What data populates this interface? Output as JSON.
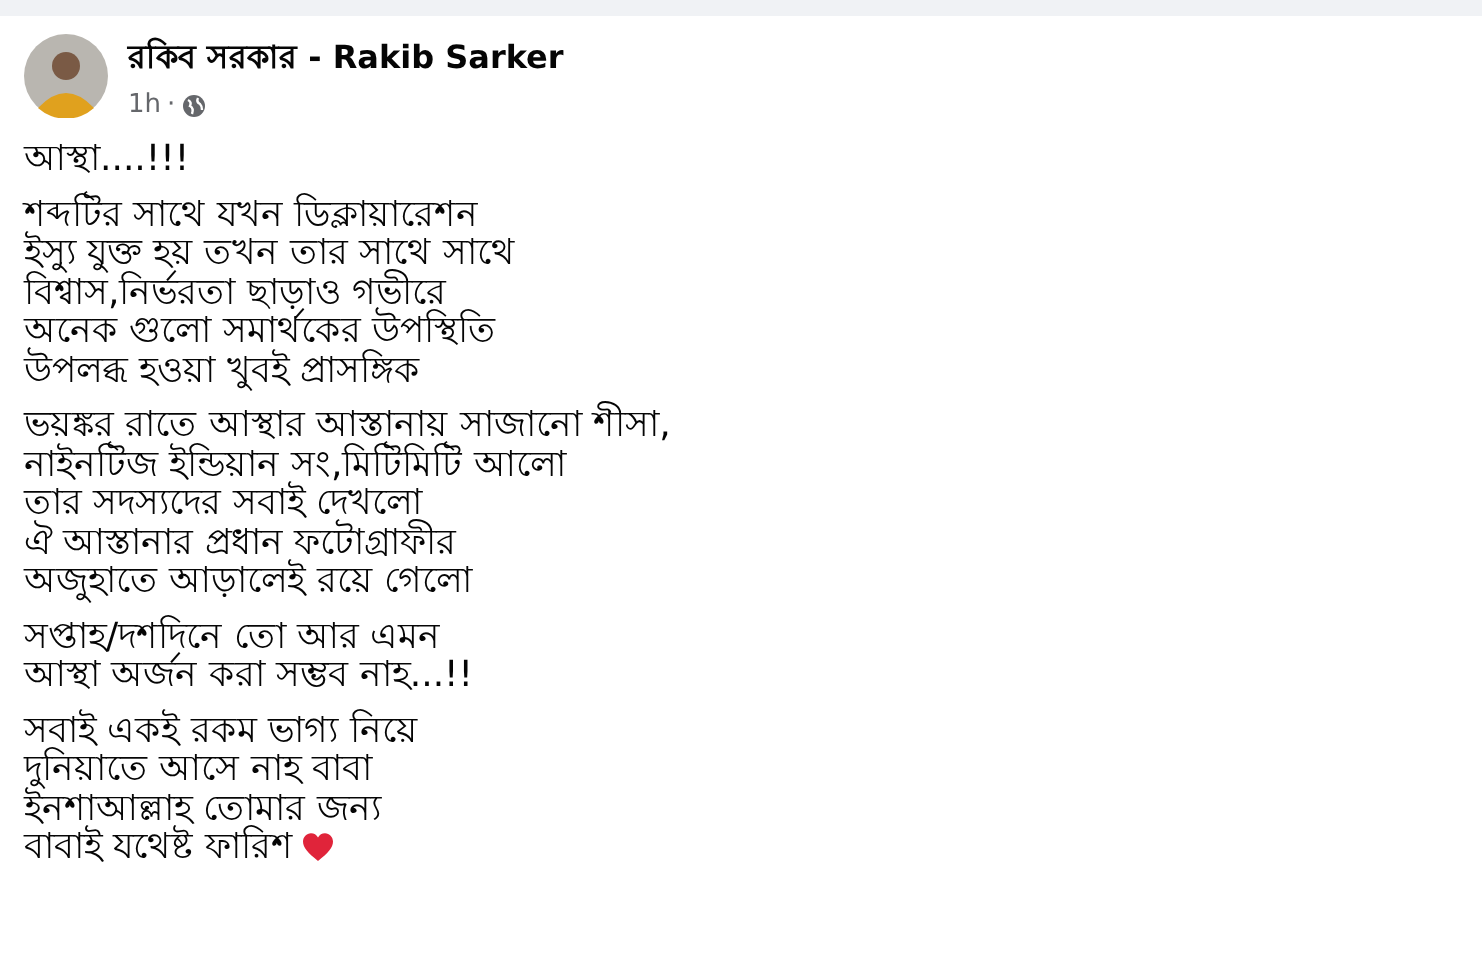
{
  "post": {
    "author": "রকিব সরকার - Rakib Sarker",
    "time": "1h",
    "audience_separator": "·",
    "paragraphs": [
      {
        "lines": [
          "আস্থা....!!!"
        ]
      },
      {
        "lines": [
          "শব্দটির সাথে যখন ডিক্লায়ারেশন",
          "ইস্যু যুক্ত হয় তখন তার সাথে সাথে",
          "বিশ্বাস,নির্ভরতা ছাড়াও গভীরে",
          "অনেক গুলো সমার্থকের উপস্থিতি",
          "উপলব্ধ হওয়া খুবই প্রাসঙ্গিক"
        ]
      },
      {
        "lines": [
          "ভয়ঙ্কর রাতে আস্থার আস্তানায় সাজানো শীসা,",
          "নাইনটিজ ইন্ডিয়ান সং,মিটিমিটি আলো",
          "তার সদস্যদের সবাই দেখলো",
          "ঐ আস্তানার প্রধান ফটোগ্রাফীর",
          "অজুহাতে আড়ালেই রয়ে গেলো"
        ]
      },
      {
        "lines": [
          "সপ্তাহ/দশদিনে তো আর এমন",
          "আস্থা অর্জন করা সম্ভব নাহ...!!"
        ]
      },
      {
        "lines": [
          "সবাই একই রকম ভাগ্য নিয়ে",
          "দুনিয়াতে আসে নাহ বাবা",
          "ইনশাআল্লাহ তোমার জন্য",
          "বাবাই যথেষ্ট ফারিশ"
        ]
      }
    ]
  }
}
